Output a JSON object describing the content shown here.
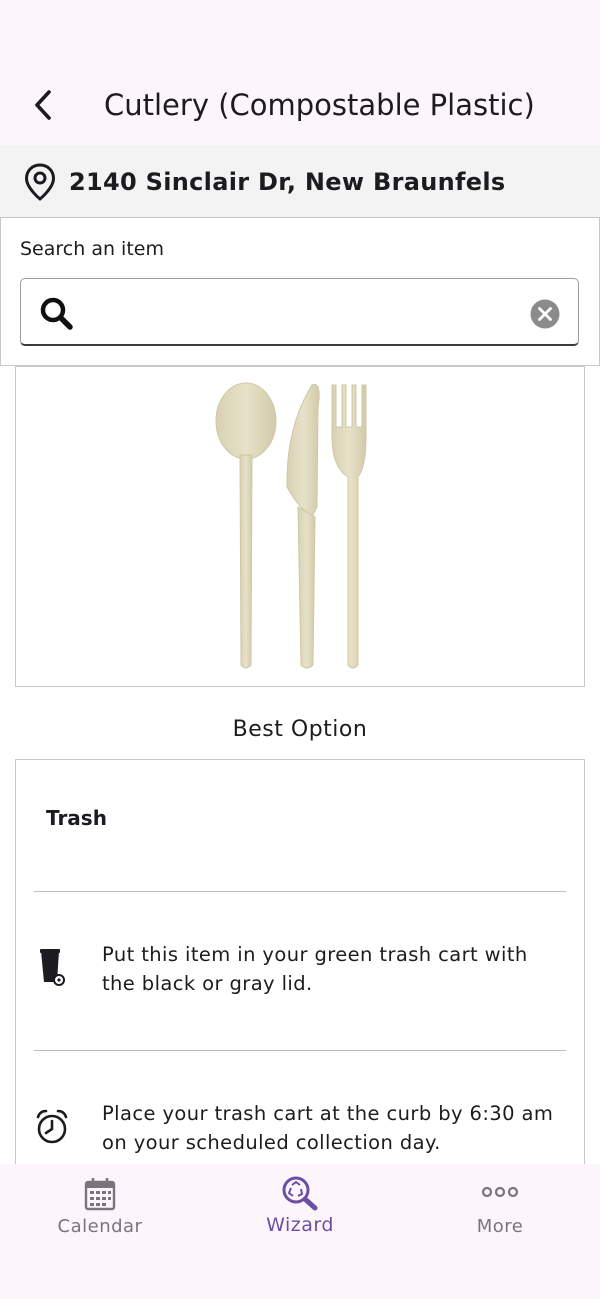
{
  "header": {
    "title": "Cutlery (Compostable Plastic)",
    "back_icon": "chevron-left-icon"
  },
  "location": {
    "address": "2140 Sinclair Dr, New Braunfels",
    "icon": "map-pin-icon"
  },
  "search": {
    "label": "Search an item",
    "value": "",
    "placeholder": ""
  },
  "item_image": {
    "icon": "cutlery-image",
    "colors": {
      "cutlery": "#e3ddc4"
    }
  },
  "best_option": {
    "heading": "Best Option",
    "title": "Trash",
    "rows": [
      {
        "icon": "trash-cart-icon",
        "text": "Put this item in your green trash cart with the black or gray lid."
      },
      {
        "icon": "alarm-clock-icon",
        "text": "Place your trash cart at the curb by 6:30 am on your scheduled collection day."
      }
    ]
  },
  "bottom_nav": {
    "items": [
      {
        "label": "Calendar",
        "icon": "calendar-icon",
        "active": false
      },
      {
        "label": "Wizard",
        "icon": "recycle-search-icon",
        "active": true
      },
      {
        "label": "More",
        "icon": "more-dots-icon",
        "active": false
      }
    ]
  },
  "colors": {
    "accent": "#6a4fa3",
    "inactive": "#79747e",
    "header_bg": "#fcf6fc",
    "address_bg": "#f3f3f3"
  }
}
